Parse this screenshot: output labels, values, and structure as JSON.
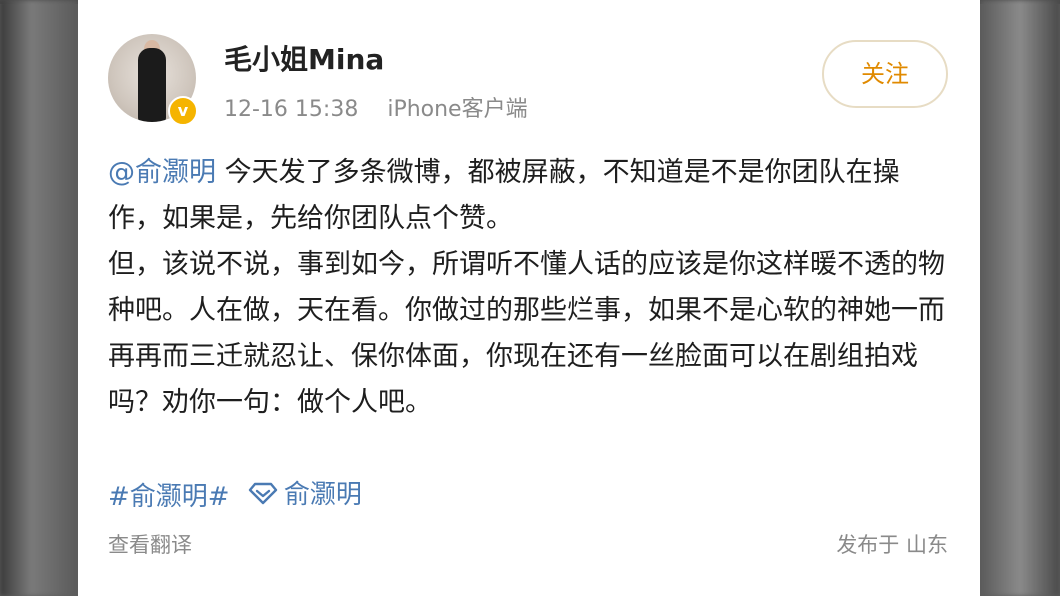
{
  "user": {
    "name": "毛小姐Mina",
    "date": "12-16 15:38",
    "source": "iPhone客户端",
    "verified_badge": "v"
  },
  "follow_label": "关注",
  "post": {
    "mention": "@俞灏明",
    "para1_rest": " 今天发了多条微博，都被屏蔽，不知道是不是你团队在操作，如果是，先给你团队点个赞。",
    "para2": "但，该说不说，事到如今，所谓听不懂人话的应该是你这样暖不透的物种吧。人在做，天在看。你做过的那些烂事，如果不是心软的神她一而再再而三迁就忍让、保你体面，你现在还有一丝脸面可以在剧组拍戏吗？劝你一句：做个人吧。"
  },
  "tags": {
    "topic": "#俞灏明#",
    "super_topic": "俞灏明",
    "super_icon": "diamond-icon"
  },
  "footer": {
    "translate": "查看翻译",
    "location": "发布于 山东"
  },
  "colors": {
    "link": "#4a7ab3",
    "follow": "#e08a00",
    "badge": "#f5b400"
  }
}
